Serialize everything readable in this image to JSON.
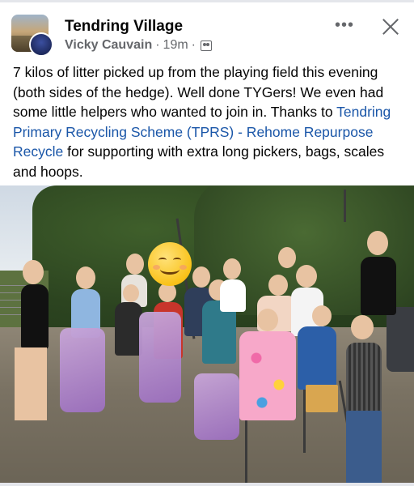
{
  "post": {
    "group_name": "Tendring Village",
    "author": "Vicky Cauvain",
    "separator": "·",
    "time": "19m",
    "time_separator": "·",
    "more_label": "•••",
    "text_before_link": "7 kilos of litter picked up from the playing field this evening (both sides of the hedge). Well done TYGers! We even had some little helpers who wanted to join in. Thanks to ",
    "link_text": "Tendring Primary Recycling Scheme (TPRS) - Rehome Repurpose Recycle",
    "text_after_link": " for supporting with extra long pickers, bags, scales and hoops."
  },
  "colors": {
    "link": "#1a56a8",
    "secondary_text": "#65676b",
    "primary_text": "#050505"
  },
  "icons": {
    "audience": "group-icon",
    "close": "close-icon",
    "more": "more-icon"
  }
}
